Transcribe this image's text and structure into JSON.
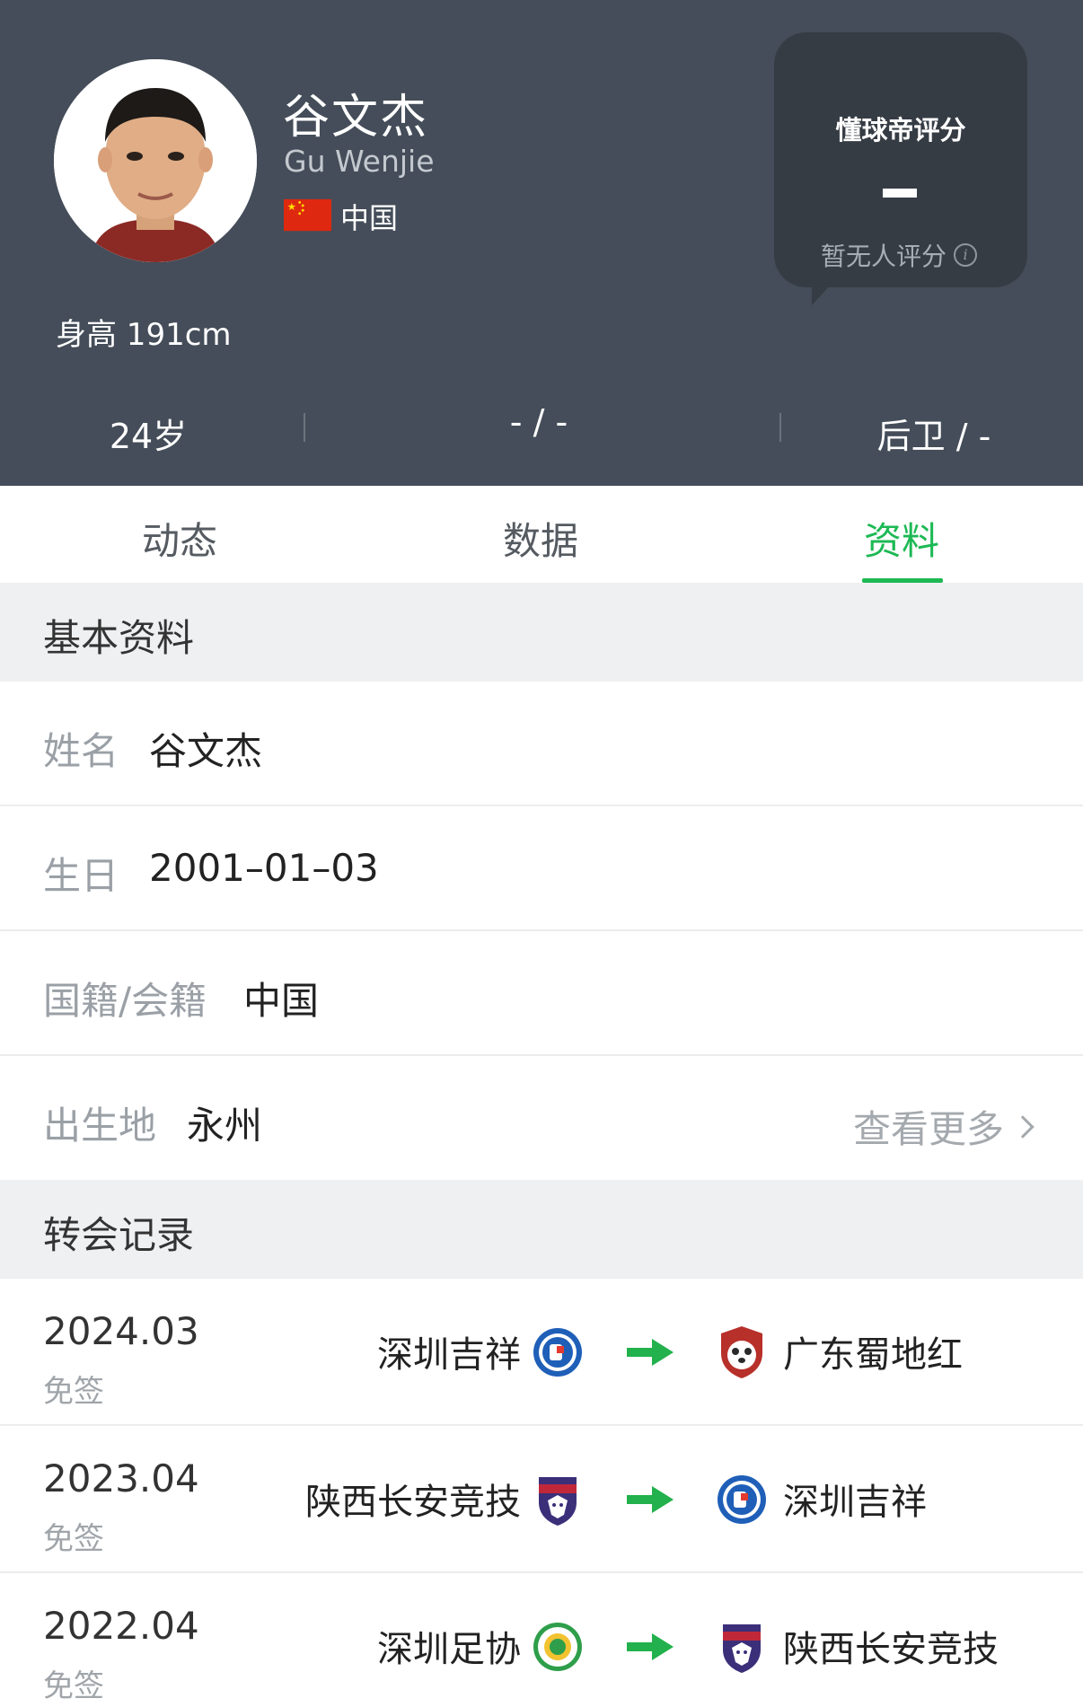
{
  "player": {
    "name_cn": "谷文杰",
    "name_en": "Gu Wenjie",
    "country": "中国",
    "height": "身高 191cm"
  },
  "rating": {
    "title": "懂球帝评分",
    "value": "—",
    "note": "暂无人评分"
  },
  "stats": {
    "age": "24岁",
    "middle": "- / -",
    "position": "后卫 / -"
  },
  "tabs": [
    {
      "label": "动态"
    },
    {
      "label": "数据"
    },
    {
      "label": "资料",
      "active": true
    }
  ],
  "basic": {
    "title": "基本资料",
    "rows": [
      {
        "label": "姓名",
        "value": "谷文杰"
      },
      {
        "label": "生日",
        "value": "2001–01–03"
      },
      {
        "label": "国籍/会籍",
        "value": "中国"
      },
      {
        "label": "出生地",
        "value": "永州"
      }
    ],
    "more": "查看更多"
  },
  "transfers": {
    "title": "转会记录",
    "items": [
      {
        "date": "2024.03",
        "type": "免签",
        "from": "深圳吉祥",
        "to": "广东蜀地红",
        "from_badge": "shenzhen-jixiang-badge",
        "to_badge": "guangdong-shudihong-badge"
      },
      {
        "date": "2023.04",
        "type": "免签",
        "from": "陕西长安竞技",
        "to": "深圳吉祥",
        "from_badge": "shaanxi-changan-athletic-badge",
        "to_badge": "shenzhen-jixiang-badge"
      },
      {
        "date": "2022.04",
        "type": "免签",
        "from": "深圳足协",
        "to": "陕西长安竞技",
        "from_badge": "shenzhen-fa-badge",
        "to_badge": "shaanxi-changan-athletic-badge"
      }
    ]
  },
  "colors": {
    "header_bg": "#444d59",
    "accent": "#1db954",
    "section_bg": "#eff0f2"
  }
}
